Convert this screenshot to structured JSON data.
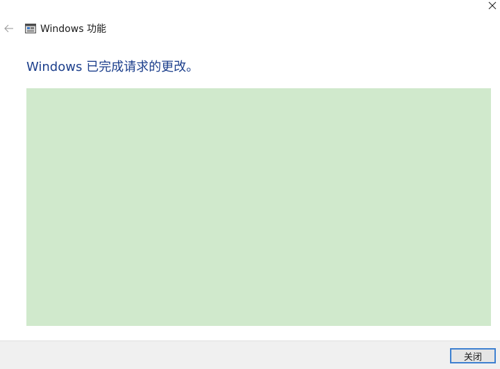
{
  "window": {
    "title": "Windows 功能"
  },
  "main": {
    "heading": "Windows 已完成请求的更改。"
  },
  "footer": {
    "close_label": "关闭"
  },
  "icons": {
    "back": "back-arrow-icon",
    "app": "windows-features-icon",
    "close": "close-icon"
  },
  "colors": {
    "heading": "#1c3f8c",
    "panel": "#d0e9cc",
    "footer": "#f0f0f0",
    "button_border": "#3c7fd0"
  }
}
